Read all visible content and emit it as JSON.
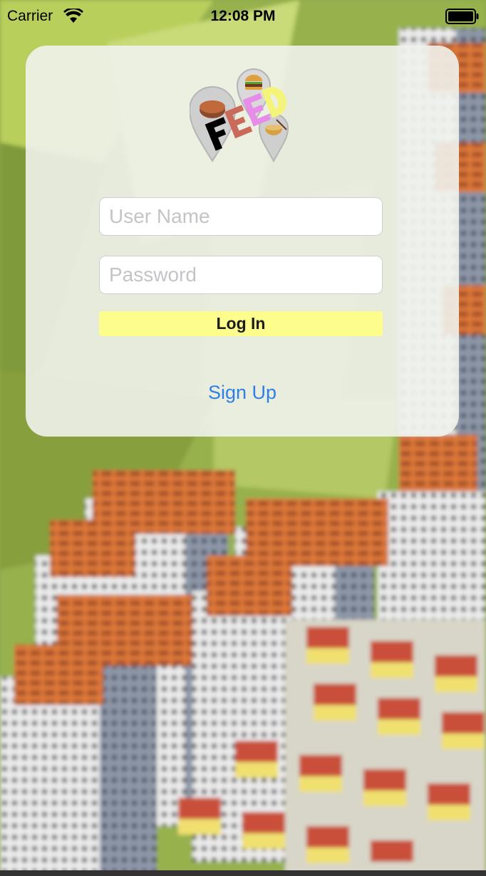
{
  "status_bar": {
    "carrier": "Carrier",
    "time": "12:08 PM",
    "icons": [
      "wifi-icon",
      "battery-icon"
    ]
  },
  "logo": {
    "alt": "FEED",
    "icons": [
      "burger-pin-icon",
      "donut-pin-icon",
      "noodle-bowl-pin-icon"
    ]
  },
  "login_form": {
    "username_placeholder": "User Name",
    "username_value": "",
    "password_placeholder": "Password",
    "password_value": "",
    "login_label": "Log In",
    "signup_label": "Sign Up"
  },
  "colors": {
    "login_button": "#fdfd8e",
    "signup_link": "#2f7fe4",
    "card_background": "#f0f2ec"
  }
}
